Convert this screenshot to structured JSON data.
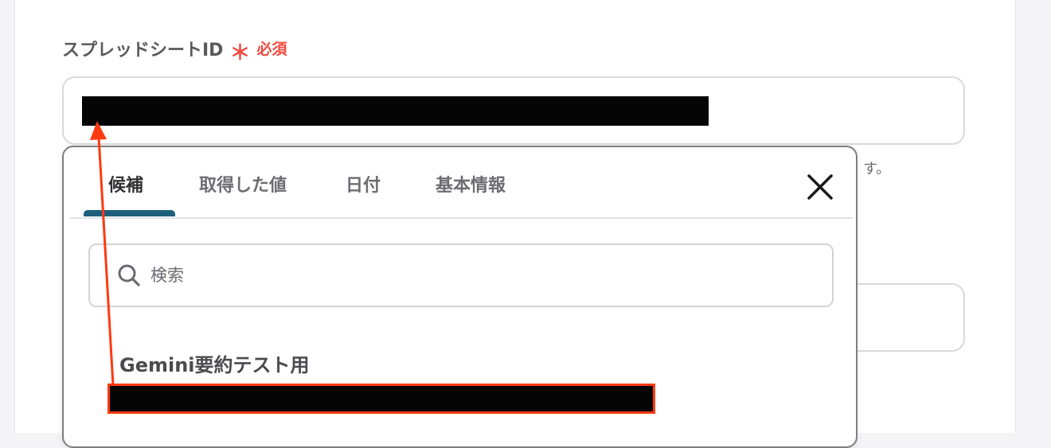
{
  "field": {
    "label": "スプレッドシートID",
    "required_mark": "＊",
    "required_text": "必須"
  },
  "hint_tail": "す。",
  "dropdown": {
    "tabs": [
      {
        "label": "候補",
        "active": true
      },
      {
        "label": "取得した値",
        "active": false
      },
      {
        "label": "日付",
        "active": false
      },
      {
        "label": "基本情報",
        "active": false
      }
    ],
    "search": {
      "placeholder": "検索",
      "value": ""
    },
    "results": [
      {
        "title": "Gemini要約テスト用"
      }
    ]
  },
  "colors": {
    "required": "#f0493f",
    "tab_indicator": "#1e5f7c",
    "annotation": "#ff3a10"
  },
  "icons": {
    "close": "close-icon",
    "search": "search-icon",
    "arrow": "annotation-arrow"
  }
}
